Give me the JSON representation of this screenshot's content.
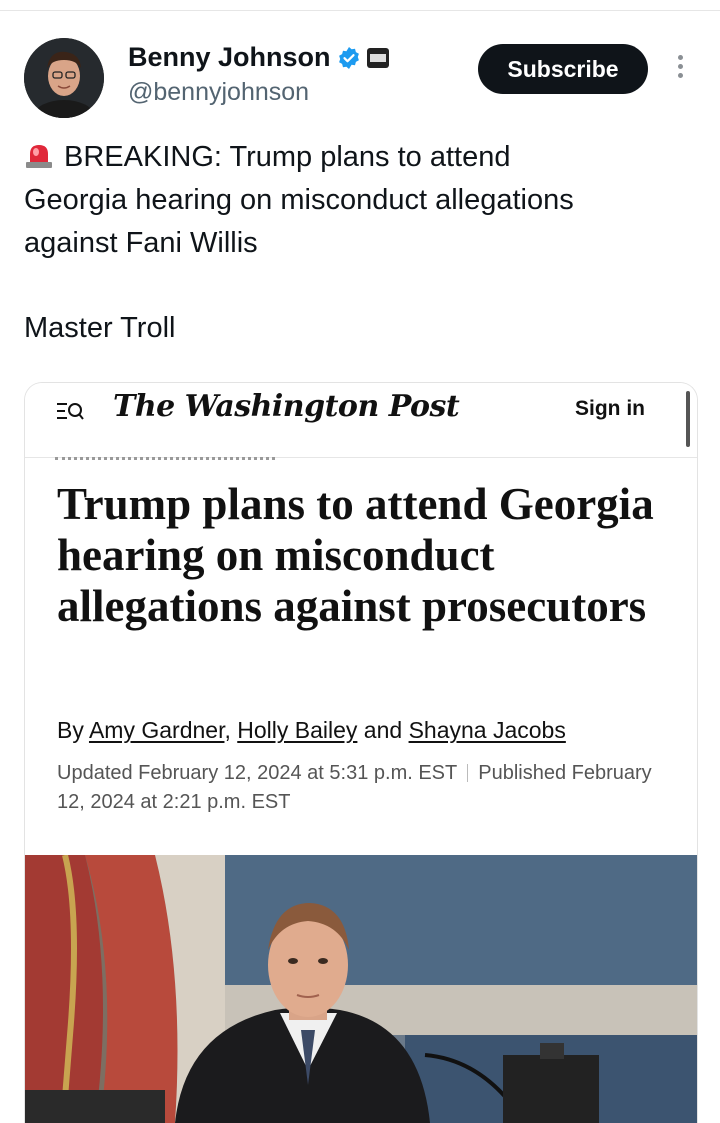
{
  "tweet": {
    "author_name": "Benny Johnson",
    "handle": "@bennyjohnson",
    "subscribe_label": "Subscribe",
    "text_line1": "BREAKING: Trump plans to attend",
    "text_line2": "Georgia hearing on misconduct allegations",
    "text_line3": "against Fani Willis",
    "text_line4": "Master Troll"
  },
  "article": {
    "publication": "The Washington Post",
    "sign_in_label": "Sign in",
    "headline": "Trump plans to attend Georgia hearing on misconduct allegations against prosecutors",
    "byline_prefix": "By",
    "author1": "Amy Gardner",
    "comma": ",",
    "author2": "Holly Bailey",
    "and": "and",
    "author3": "Shayna Jacobs",
    "updated": "Updated February 12, 2024 at 5:31 p.m. EST",
    "published": "Published February 12, 2024 at 2:21 p.m. EST"
  },
  "colors": {
    "verified_blue": "#1d9bf0",
    "subscribe_bg": "#0f1419",
    "text_dark": "#0f1419",
    "secondary": "#536471"
  }
}
